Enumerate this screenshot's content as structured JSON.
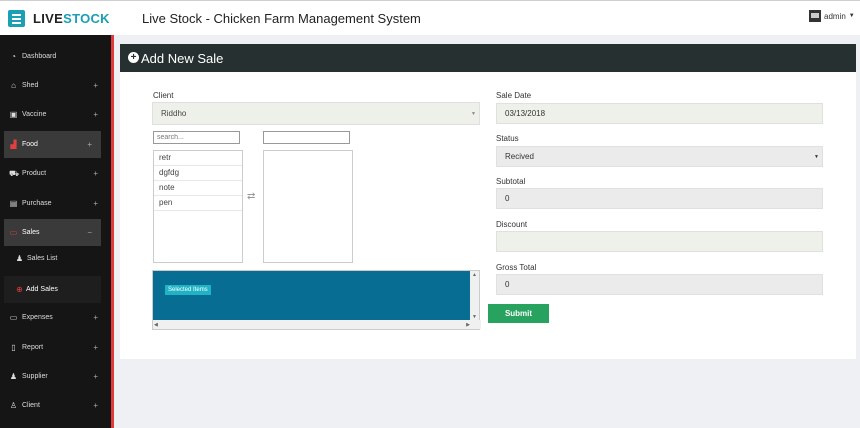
{
  "header": {
    "logo_part1": "LIVE",
    "logo_part2": "STOCK",
    "title": "Live Stock - Chicken Farm Management System",
    "user": "admin"
  },
  "sidebar": {
    "items": [
      {
        "label": "Dashboard",
        "icon": "dashboard-icon",
        "expand": ""
      },
      {
        "label": "Shed",
        "icon": "home-icon",
        "expand": "+"
      },
      {
        "label": "Vaccine",
        "icon": "briefcase-icon",
        "expand": "+"
      },
      {
        "label": "Food",
        "icon": "bar-chart-icon",
        "expand": "+"
      },
      {
        "label": "Product",
        "icon": "cart-icon",
        "expand": "+"
      },
      {
        "label": "Purchase",
        "icon": "book-icon",
        "expand": "+"
      },
      {
        "label": "Sales",
        "icon": "money-icon",
        "expand": "−"
      },
      {
        "label": "Sales List",
        "icon": "users-icon",
        "expand": ""
      },
      {
        "label": "Add Sales",
        "icon": "plus-circle-icon",
        "expand": ""
      },
      {
        "label": "Expenses",
        "icon": "money-icon",
        "expand": "+"
      },
      {
        "label": "Report",
        "icon": "file-icon",
        "expand": "+"
      },
      {
        "label": "Supplier",
        "icon": "users-icon",
        "expand": "+"
      },
      {
        "label": "Client",
        "icon": "user-icon",
        "expand": "+"
      }
    ]
  },
  "form": {
    "heading": "Add New Sale",
    "client_label": "Client",
    "client_value": "Riddho",
    "search_placeholder": "search...",
    "available_items": [
      "retr",
      "dgfdg",
      "note",
      "pen"
    ],
    "selected_items_label": "Selected Items",
    "sale_date_label": "Sale Date",
    "sale_date_value": "03/13/2018",
    "status_label": "Status",
    "status_value": "Recived",
    "subtotal_label": "Subtotal",
    "subtotal_value": "0",
    "discount_label": "Discount",
    "discount_value": "",
    "gross_total_label": "Gross Total",
    "gross_total_value": "0",
    "submit_label": "Submit"
  },
  "colors": {
    "accent": "#1a9fb4",
    "sidebar_bg": "#151515",
    "sidebar_border": "#e03a3a",
    "panel_header": "#273030",
    "selected_box": "#076d93",
    "submit": "#27a35f"
  }
}
